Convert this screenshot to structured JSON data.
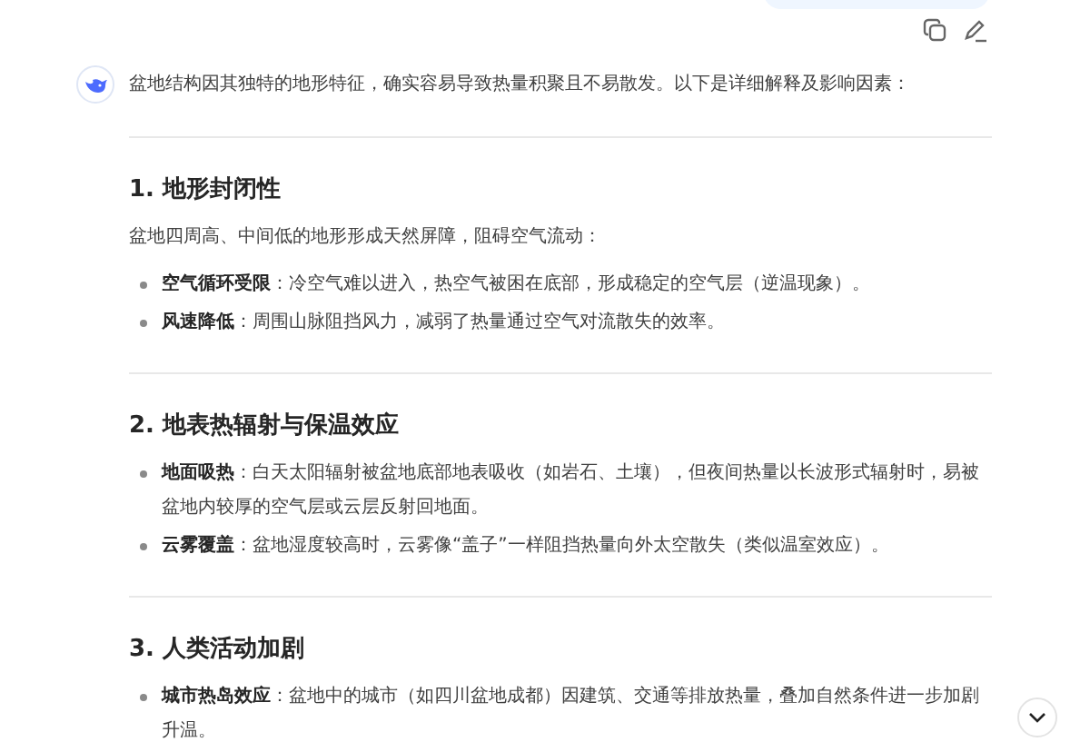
{
  "intro": "盆地结构因其独特的地形特征，确实容易导致热量积聚且不易散发。以下是详细解释及影响因素：",
  "sections": [
    {
      "heading": "1. 地形封闭性",
      "lead": "盆地四周高、中间低的地形形成天然屏障，阻碍空气流动：",
      "bullets": [
        "**空气循环受限**：冷空气难以进入，热空气被困在底部，形成稳定的空气层（逆温现象）。",
        "**风速降低**：周围山脉阻挡风力，减弱了热量通过空气对流散失的效率。"
      ]
    },
    {
      "heading": "2. 地表热辐射与保温效应",
      "bullets": [
        "**地面吸热**：白天太阳辐射被盆地底部地表吸收（如岩石、土壤），但夜间热量以长波形式辐射时，易被盆地内较厚的空气层或云层反射回地面。",
        "**云雾覆盖**：盆地湿度较高时，云雾像“盖子”一样阻挡热量向外太空散失（类似温室效应）。"
      ]
    },
    {
      "heading": "3. 人类活动加剧",
      "bullets": [
        "**城市热岛效应**：盆地中的城市（如四川盆地成都）因建筑、交通等排放热量，叠加自然条件进一步加剧升温。"
      ]
    }
  ]
}
